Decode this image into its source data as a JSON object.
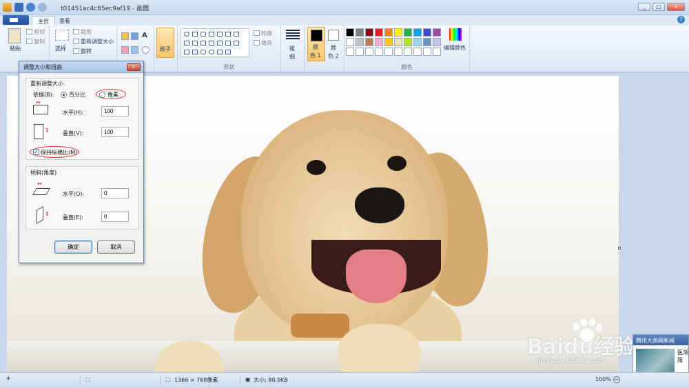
{
  "window": {
    "title": "t01451ac4c85ec9af19 - 画图"
  },
  "tabs": [
    {
      "label": "主页"
    },
    {
      "label": "查看"
    }
  ],
  "ribbon": {
    "clipboard": {
      "paste": "粘贴",
      "cut": "剪切",
      "copy": "复制"
    },
    "image": {
      "select": "选择",
      "crop": "裁剪",
      "resize": "重新调整大小",
      "rotate": "旋转"
    },
    "brush": "刷子",
    "shapes": {
      "outline": "轮廓",
      "fill": "填充",
      "group_label": "形状"
    },
    "size": {
      "label1": "粗",
      "label2": "细"
    },
    "color1": {
      "label1": "颜",
      "label2": "色 1"
    },
    "color2": {
      "label1": "颜",
      "label2": "色 2"
    },
    "edit_colors": "编辑颜色",
    "colors_group_label": "颜色",
    "palette_row1": [
      "#000000",
      "#7f7f7f",
      "#880015",
      "#ed1c24",
      "#ff7f27",
      "#fff200",
      "#22b14c",
      "#00a2e8",
      "#3f48cc",
      "#a349a4"
    ],
    "palette_row2": [
      "#ffffff",
      "#c3c3c3",
      "#b97a57",
      "#ffaec9",
      "#ffc90e",
      "#efe4b0",
      "#b5e61d",
      "#99d9ea",
      "#7092be",
      "#c8bfe7"
    ]
  },
  "dialog": {
    "title": "调整大小和扭曲",
    "close": "x",
    "resize_section": "重新调整大小",
    "basis_label": "依据(B):",
    "option_percent": "百分比",
    "option_pixels": "像素",
    "horizontal_label": "水平(H):",
    "horizontal_value": "100",
    "vertical_label": "垂直(V):",
    "vertical_value": "100",
    "keep_ratio": "保持纵横比(M)",
    "skew_section": "倾斜(角度)",
    "skew_h_label": "水平(O):",
    "skew_h_value": "0",
    "skew_v_label": "垂直(E):",
    "skew_v_value": "0",
    "ok": "确定",
    "cancel": "取消"
  },
  "statusbar": {
    "dimensions": "1366 × 768像素",
    "size": "大小: 80.9KB",
    "zoom": "100%"
  },
  "watermark": {
    "text": "Baidu经验",
    "url": "jingyan.baidu.com"
  },
  "news_popup": {
    "title": "腾讯大燕网新闻",
    "text": "医渐服"
  }
}
